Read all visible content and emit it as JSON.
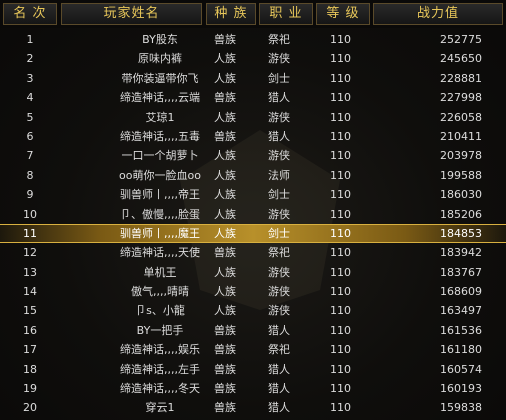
{
  "headers": {
    "rank": "名 次",
    "name": "玩家姓名",
    "race": "种 族",
    "job": "职 业",
    "level": "等 级",
    "power": "战力值"
  },
  "rows": [
    {
      "rank": "1",
      "name": "BY股东",
      "race": "兽族",
      "job": "祭祀",
      "level": "110",
      "power": "252775"
    },
    {
      "rank": "2",
      "name": "原味内裤",
      "race": "人族",
      "job": "游侠",
      "level": "110",
      "power": "245650"
    },
    {
      "rank": "3",
      "name": "带你装逼带你飞",
      "race": "人族",
      "job": "剑士",
      "level": "110",
      "power": "228881"
    },
    {
      "rank": "4",
      "name": "缔造神话,,,,云端",
      "race": "兽族",
      "job": "猎人",
      "level": "110",
      "power": "227998"
    },
    {
      "rank": "5",
      "name": "艾琼1",
      "race": "人族",
      "job": "游侠",
      "level": "110",
      "power": "226058"
    },
    {
      "rank": "6",
      "name": "缔造神话,,,,五毒",
      "race": "兽族",
      "job": "猎人",
      "level": "110",
      "power": "210411"
    },
    {
      "rank": "7",
      "name": "一口一个胡萝卜",
      "race": "人族",
      "job": "游侠",
      "level": "110",
      "power": "203978"
    },
    {
      "rank": "8",
      "name": "oo萌你一脸血oo",
      "race": "人族",
      "job": "法师",
      "level": "110",
      "power": "199588"
    },
    {
      "rank": "9",
      "name": "驯兽师丨,,,,帝王",
      "race": "人族",
      "job": "剑士",
      "level": "110",
      "power": "186030"
    },
    {
      "rank": "10",
      "name": "卩、傲慢,,,,脸蛋",
      "race": "人族",
      "job": "游侠",
      "level": "110",
      "power": "185206"
    },
    {
      "rank": "11",
      "name": "驯兽师丨,,,,魔王",
      "race": "人族",
      "job": "剑士",
      "level": "110",
      "power": "184853"
    },
    {
      "rank": "12",
      "name": "缔造神话,,,,天使",
      "race": "兽族",
      "job": "祭祀",
      "level": "110",
      "power": "183942"
    },
    {
      "rank": "13",
      "name": "单机王",
      "race": "人族",
      "job": "游侠",
      "level": "110",
      "power": "183767"
    },
    {
      "rank": "14",
      "name": "傲气,,,,晴晴",
      "race": "人族",
      "job": "游侠",
      "level": "110",
      "power": "168609"
    },
    {
      "rank": "15",
      "name": "卩s、小龍",
      "race": "人族",
      "job": "游侠",
      "level": "110",
      "power": "163497"
    },
    {
      "rank": "16",
      "name": "BY一把手",
      "race": "兽族",
      "job": "猎人",
      "level": "110",
      "power": "161536"
    },
    {
      "rank": "17",
      "name": "缔造神话,,,,娱乐",
      "race": "兽族",
      "job": "祭祀",
      "level": "110",
      "power": "161180"
    },
    {
      "rank": "18",
      "name": "缔造神话,,,,左手",
      "race": "兽族",
      "job": "猎人",
      "level": "110",
      "power": "160574"
    },
    {
      "rank": "19",
      "name": "缔造神话,,,,冬天",
      "race": "兽族",
      "job": "猎人",
      "level": "110",
      "power": "160193"
    },
    {
      "rank": "20",
      "name": "穿云1",
      "race": "兽族",
      "job": "猎人",
      "level": "110",
      "power": "159838"
    }
  ],
  "selected_rank": "11",
  "colors": {
    "header_text": "#e8c75a",
    "row_text": "#dcdcdc",
    "selected_bar": "#b8902a"
  }
}
